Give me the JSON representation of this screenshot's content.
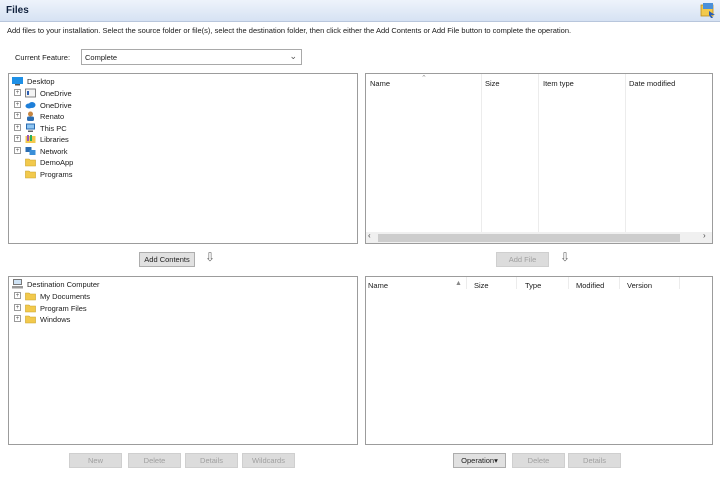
{
  "header": {
    "title": "Files",
    "icon": "installer-icon"
  },
  "instructions": "Add files to your installation. Select the source folder or file(s), select the destination folder, then click either the Add Contents or Add File button to complete the operation.",
  "feature": {
    "label": "Current Feature:",
    "value": "Complete"
  },
  "source_tree": {
    "root": "Desktop",
    "items": [
      {
        "label": "OneDrive",
        "icon": "library-drive-icon",
        "expandable": true
      },
      {
        "label": "OneDrive",
        "icon": "cloud-icon",
        "expandable": true
      },
      {
        "label": "Renato",
        "icon": "user-icon",
        "expandable": true
      },
      {
        "label": "This PC",
        "icon": "computer-icon",
        "expandable": true
      },
      {
        "label": "Libraries",
        "icon": "libraries-icon",
        "expandable": true
      },
      {
        "label": "Network",
        "icon": "network-icon",
        "expandable": true
      },
      {
        "label": "DemoApp",
        "icon": "folder-icon",
        "expandable": false
      },
      {
        "label": "Programs",
        "icon": "folder-icon",
        "expandable": false
      }
    ]
  },
  "source_files": {
    "columns": [
      "Name",
      "Size",
      "Item type",
      "Date modified"
    ]
  },
  "buttons_mid": {
    "add_contents": "Add Contents",
    "add_file": "Add File"
  },
  "dest_tree": {
    "root": "Destination Computer",
    "items": [
      {
        "label": "My Documents",
        "icon": "folder-icon"
      },
      {
        "label": "Program Files",
        "icon": "folder-icon"
      },
      {
        "label": "Windows",
        "icon": "folder-icon"
      }
    ]
  },
  "dest_files": {
    "columns": [
      "Name",
      "Size",
      "Type",
      "Modified",
      "Version"
    ]
  },
  "buttons_bottom_left": {
    "new": "New",
    "delete": "Delete",
    "details": "Details",
    "wildcards": "Wildcards"
  },
  "buttons_bottom_right": {
    "operation": "Operation",
    "delete": "Delete",
    "details": "Details"
  },
  "colors": {
    "header_top": "#eef3fb",
    "header_bottom": "#d6e2f3",
    "folder": "#f2c94c"
  }
}
